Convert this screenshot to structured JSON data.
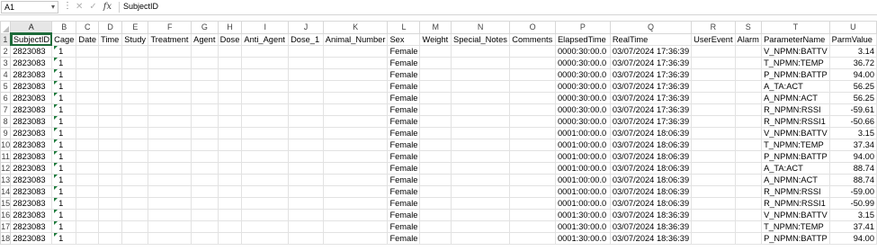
{
  "formula_bar": {
    "name_box": "A1",
    "cancel_symbol": "✕",
    "enter_symbol": "✓",
    "fx_symbol": "fx",
    "content": "SubjectID"
  },
  "columns": [
    "A",
    "B",
    "C",
    "D",
    "E",
    "F",
    "G",
    "H",
    "I",
    "J",
    "K",
    "L",
    "M",
    "N",
    "O",
    "P",
    "Q",
    "R",
    "S",
    "T",
    "U"
  ],
  "headers": [
    "SubjectID",
    "Cage",
    "Date",
    "Time",
    "Study",
    "Treatment",
    "Agent",
    "Dose",
    "Anti_Agent",
    "Dose_1",
    "Animal_Number",
    "Sex",
    "Weight",
    "Special_Notes",
    "Comments",
    "ElapsedTime",
    "RealTime",
    "UserEvent",
    "Alarm",
    "ParameterName",
    "ParmValue"
  ],
  "rows": [
    {
      "subject": "2823083",
      "cage": "1",
      "sex": "Female",
      "elapsed": "0000:30:00.0",
      "real": "03/07/2024 17:36:39",
      "param": "V_NPMN:BATTV",
      "value": "3.14"
    },
    {
      "subject": "2823083",
      "cage": "1",
      "sex": "Female",
      "elapsed": "0000:30:00.0",
      "real": "03/07/2024 17:36:39",
      "param": "T_NPMN:TEMP",
      "value": "36.72"
    },
    {
      "subject": "2823083",
      "cage": "1",
      "sex": "Female",
      "elapsed": "0000:30:00.0",
      "real": "03/07/2024 17:36:39",
      "param": "P_NPMN:BATTP",
      "value": "94.00"
    },
    {
      "subject": "2823083",
      "cage": "1",
      "sex": "Female",
      "elapsed": "0000:30:00.0",
      "real": "03/07/2024 17:36:39",
      "param": "A_TA:ACT",
      "value": "56.25"
    },
    {
      "subject": "2823083",
      "cage": "1",
      "sex": "Female",
      "elapsed": "0000:30:00.0",
      "real": "03/07/2024 17:36:39",
      "param": "A_NPMN:ACT",
      "value": "56.25"
    },
    {
      "subject": "2823083",
      "cage": "1",
      "sex": "Female",
      "elapsed": "0000:30:00.0",
      "real": "03/07/2024 17:36:39",
      "param": "R_NPMN:RSSI",
      "value": "-59.61"
    },
    {
      "subject": "2823083",
      "cage": "1",
      "sex": "Female",
      "elapsed": "0000:30:00.0",
      "real": "03/07/2024 17:36:39",
      "param": "R_NPMN:RSSI1",
      "value": "-50.66"
    },
    {
      "subject": "2823083",
      "cage": "1",
      "sex": "Female",
      "elapsed": "0001:00:00.0",
      "real": "03/07/2024 18:06:39",
      "param": "V_NPMN:BATTV",
      "value": "3.15"
    },
    {
      "subject": "2823083",
      "cage": "1",
      "sex": "Female",
      "elapsed": "0001:00:00.0",
      "real": "03/07/2024 18:06:39",
      "param": "T_NPMN:TEMP",
      "value": "37.34"
    },
    {
      "subject": "2823083",
      "cage": "1",
      "sex": "Female",
      "elapsed": "0001:00:00.0",
      "real": "03/07/2024 18:06:39",
      "param": "P_NPMN:BATTP",
      "value": "94.00"
    },
    {
      "subject": "2823083",
      "cage": "1",
      "sex": "Female",
      "elapsed": "0001:00:00.0",
      "real": "03/07/2024 18:06:39",
      "param": "A_TA:ACT",
      "value": "88.74"
    },
    {
      "subject": "2823083",
      "cage": "1",
      "sex": "Female",
      "elapsed": "0001:00:00.0",
      "real": "03/07/2024 18:06:39",
      "param": "A_NPMN:ACT",
      "value": "88.74"
    },
    {
      "subject": "2823083",
      "cage": "1",
      "sex": "Female",
      "elapsed": "0001:00:00.0",
      "real": "03/07/2024 18:06:39",
      "param": "R_NPMN:RSSI",
      "value": "-59.00"
    },
    {
      "subject": "2823083",
      "cage": "1",
      "sex": "Female",
      "elapsed": "0001:00:00.0",
      "real": "03/07/2024 18:06:39",
      "param": "R_NPMN:RSSI1",
      "value": "-50.99"
    },
    {
      "subject": "2823083",
      "cage": "1",
      "sex": "Female",
      "elapsed": "0001:30:00.0",
      "real": "03/07/2024 18:36:39",
      "param": "V_NPMN:BATTV",
      "value": "3.15"
    },
    {
      "subject": "2823083",
      "cage": "1",
      "sex": "Female",
      "elapsed": "0001:30:00.0",
      "real": "03/07/2024 18:36:39",
      "param": "T_NPMN:TEMP",
      "value": "37.41"
    },
    {
      "subject": "2823083",
      "cage": "1",
      "sex": "Female",
      "elapsed": "0001:30:00.0",
      "real": "03/07/2024 18:36:39",
      "param": "P_NPMN:BATTP",
      "value": "94.00"
    }
  ],
  "colors": {
    "accent": "#1e6b3a",
    "warning_triangle": "#1e7a3c"
  }
}
